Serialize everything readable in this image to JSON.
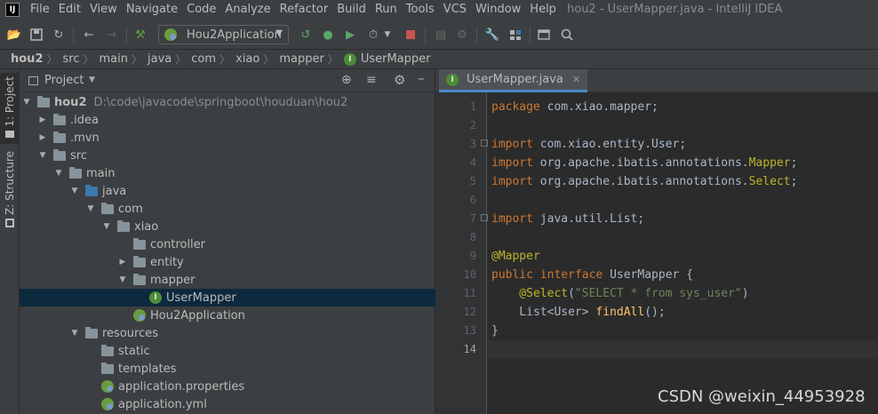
{
  "menubar": {
    "items": [
      "File",
      "Edit",
      "View",
      "Navigate",
      "Code",
      "Analyze",
      "Refactor",
      "Build",
      "Run",
      "Tools",
      "VCS",
      "Window",
      "Help"
    ],
    "window_title": "hou2 - UserMapper.java - IntelliJ IDEA"
  },
  "toolbar": {
    "run_config": "Hou2Application"
  },
  "breadcrumb": [
    "hou2",
    "src",
    "main",
    "java",
    "com",
    "xiao",
    "mapper",
    "UserMapper"
  ],
  "left_stripe": {
    "project_tab": "1: Project",
    "structure_tab": "Z: Structure"
  },
  "project_panel": {
    "title": "Project",
    "tree": [
      {
        "label": "hou2",
        "path": "D:\\code\\javacode\\springboot\\houduan\\hou2"
      },
      {
        "label": ".idea"
      },
      {
        "label": ".mvn"
      },
      {
        "label": "src"
      },
      {
        "label": "main"
      },
      {
        "label": "java"
      },
      {
        "label": "com"
      },
      {
        "label": "xiao"
      },
      {
        "label": "controller"
      },
      {
        "label": "entity"
      },
      {
        "label": "mapper"
      },
      {
        "label": "UserMapper"
      },
      {
        "label": "Hou2Application"
      },
      {
        "label": "resources"
      },
      {
        "label": "static"
      },
      {
        "label": "templates"
      },
      {
        "label": "application.properties"
      },
      {
        "label": "application.yml"
      }
    ]
  },
  "editor": {
    "tab_label": "UserMapper.java",
    "line_numbers": [
      "1",
      "2",
      "3",
      "4",
      "5",
      "6",
      "7",
      "8",
      "9",
      "10",
      "11",
      "12",
      "13",
      "14"
    ],
    "code": {
      "l1_kw": "package",
      "l1_rest": " com.xiao.mapper;",
      "l3_kw": "import",
      "l3_rest": " com.xiao.entity.User;",
      "l4_kw": "import",
      "l4_rest": " org.apache.ibatis.annotations.",
      "l4_ann": "Mapper",
      "l4_end": ";",
      "l5_kw": "import",
      "l5_rest": " org.apache.ibatis.annotations.",
      "l5_ann": "Select",
      "l5_end": ";",
      "l7_kw": "import",
      "l7_rest": " java.util.List;",
      "l9_ann": "@Mapper",
      "l10_kw1": "public",
      "l10_kw2": " interface",
      "l10_rest": " UserMapper {",
      "l11_ann": "    @Select",
      "l11_p1": "(",
      "l11_str": "\"SELECT * from sys_user\"",
      "l11_p2": ")",
      "l12_type": "    List<User> ",
      "l12_fn": "findAll",
      "l12_end": "();",
      "l13": "}"
    }
  },
  "watermark": "CSDN @weixin_44953928"
}
